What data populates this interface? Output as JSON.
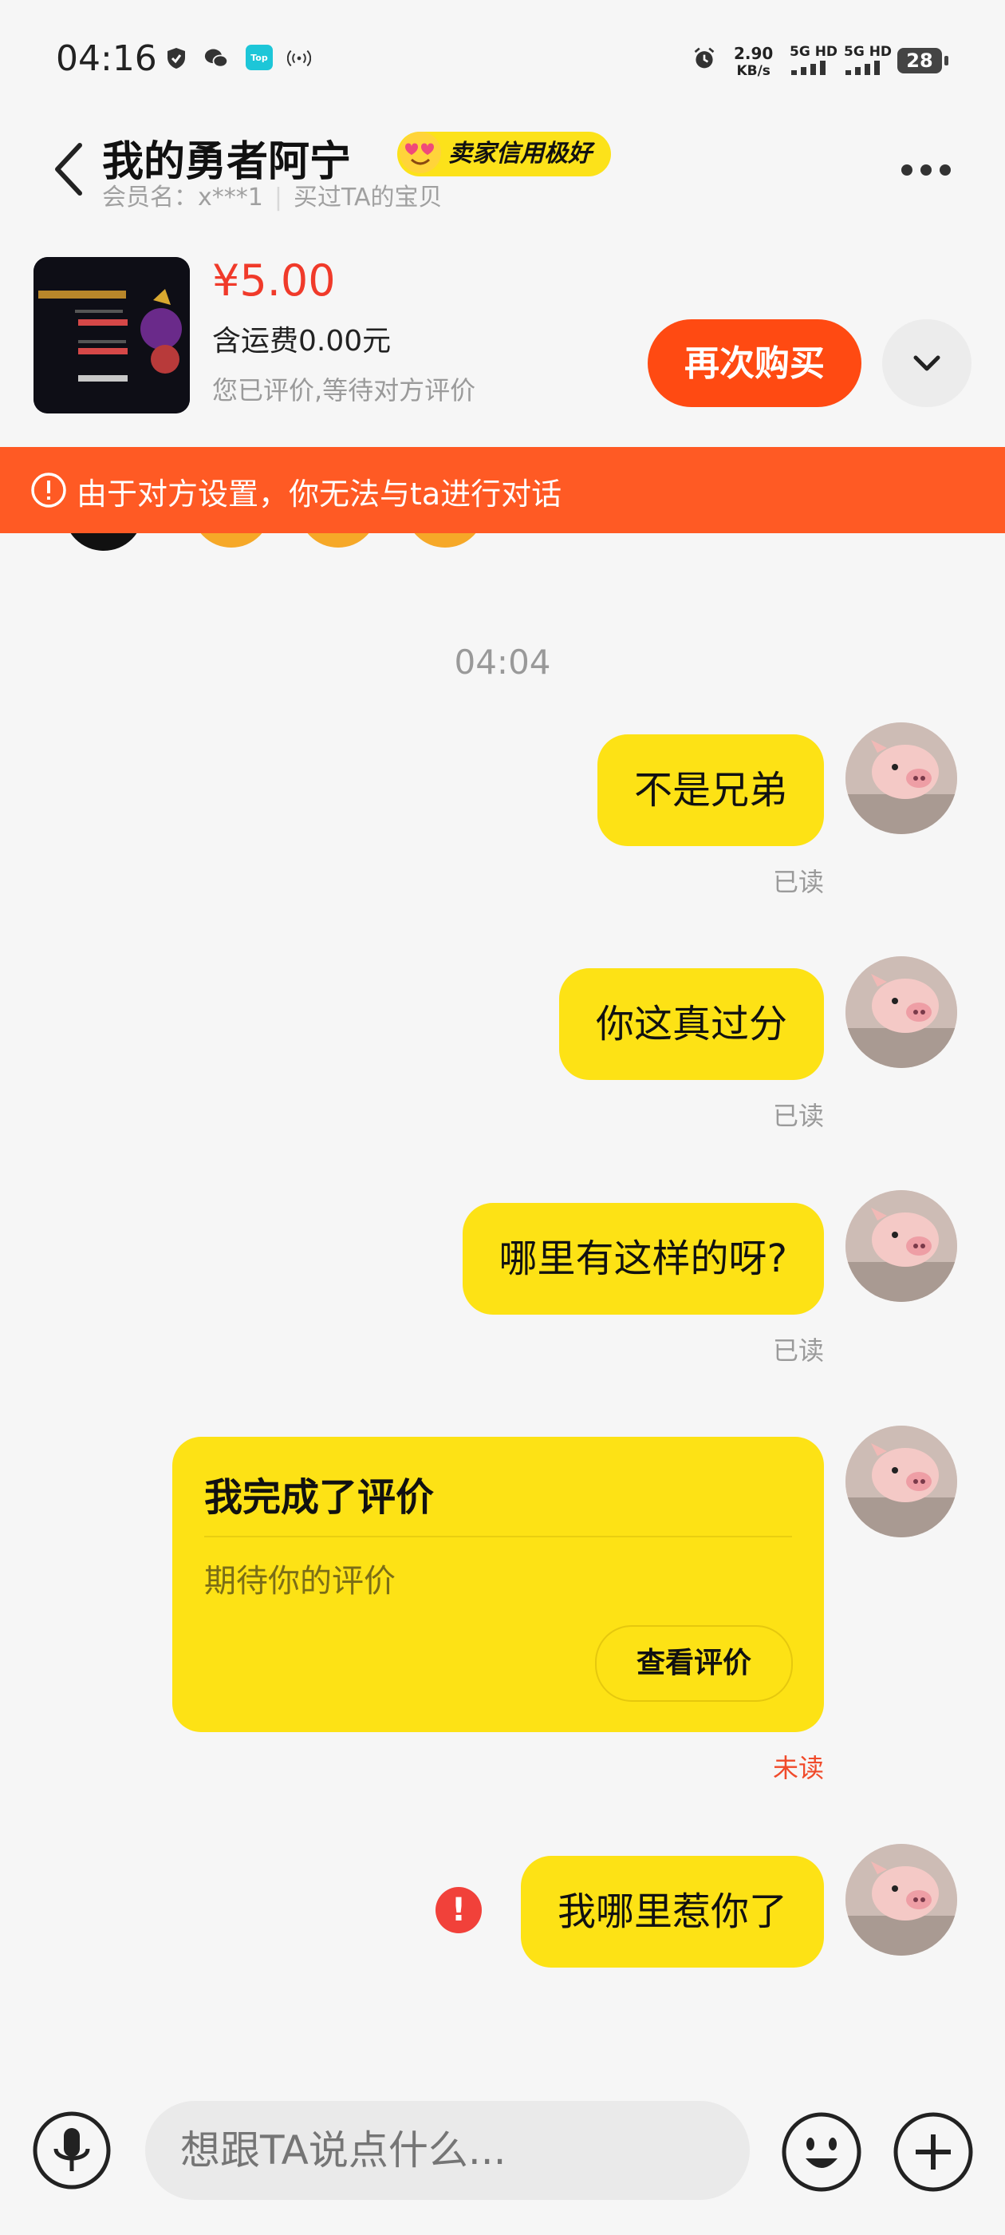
{
  "status_bar": {
    "time": "04:16",
    "net_speed_value": "2.90",
    "net_speed_unit": "KB/s",
    "sim1": "5G HD",
    "sim2": "5G HD",
    "battery": "28",
    "icons": [
      "shield-icon",
      "wechat-icon",
      "top-app-icon",
      "hotspot-icon",
      "alarm-icon",
      "signal-icon",
      "battery-icon"
    ]
  },
  "header": {
    "title": "我的勇者阿宁",
    "credit_badge": "卖家信用极好",
    "member_label": "会员名：x***1",
    "purchase_note": "买过TA的宝贝"
  },
  "product": {
    "price": "¥5.00",
    "shipping": "含运费0.00元",
    "review_status": "您已评价,等待对方评价",
    "buy_again": "再次购买"
  },
  "banner": {
    "text": "由于对方设置，你无法与ta进行对话"
  },
  "chat": {
    "time_separator": "04:04",
    "messages": [
      {
        "text": "不是兄弟",
        "status": "已读"
      },
      {
        "text": "你这真过分",
        "status": "已读"
      },
      {
        "text": "哪里有这样的呀?",
        "status": "已读"
      }
    ],
    "card": {
      "title": "我完成了评价",
      "subtitle": "期待你的评价",
      "button": "查看评价",
      "status": "未读"
    },
    "failed_message": {
      "text": "我哪里惹你了",
      "error_mark": "!"
    }
  },
  "input_bar": {
    "placeholder": "想跟TA说点什么..."
  },
  "colors": {
    "accent_yellow": "#fde215",
    "price_red": "#f03a2a",
    "buy_button_orange": "#ff4a12",
    "banner_orange": "#ff5a24",
    "unread_red": "#f04a2a",
    "background": "#f6f6f6"
  }
}
